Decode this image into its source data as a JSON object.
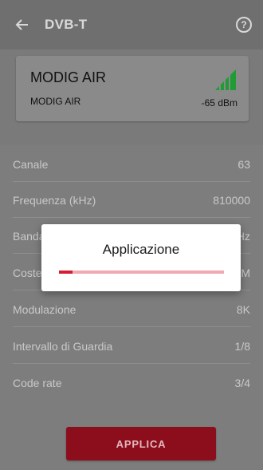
{
  "appbar": {
    "title": "DVB-T",
    "back_icon": "arrow-left-icon",
    "help_icon": "help-circle-icon",
    "help_glyph": "?"
  },
  "card": {
    "name": "MODIG AIR",
    "subname": "MODIG AIR",
    "signal_level": "-65 dBm",
    "signal_icon": "signal-strength-icon",
    "signal_color": "#1f9c34"
  },
  "params": [
    {
      "label": "Canale",
      "value": "63"
    },
    {
      "label": "Frequenza (kHz)",
      "value": "810000"
    },
    {
      "label": "Banda",
      "value": "8 MHz"
    },
    {
      "label": "Costellazione",
      "value": "64QAM"
    },
    {
      "label": "Modulazione",
      "value": "8K"
    },
    {
      "label": "Intervallo di Guardia",
      "value": "1/8"
    },
    {
      "label": "Code rate",
      "value": "3/4"
    }
  ],
  "apply_button": {
    "label": "APPLICA",
    "color": "#8c0e1d"
  },
  "dialog": {
    "title": "Applicazione",
    "progress": 0.08,
    "accent": "#d21f33"
  }
}
